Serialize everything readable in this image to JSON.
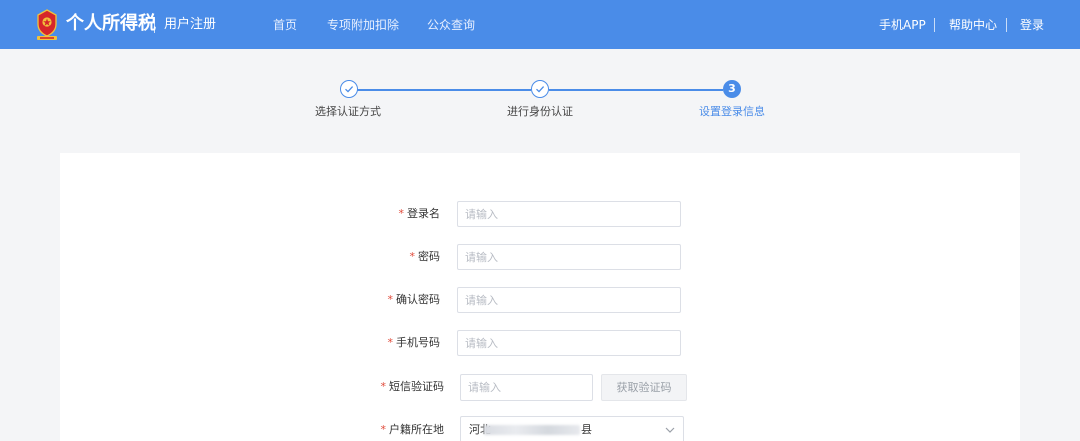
{
  "header": {
    "brand": "个人所得税",
    "subtitle": "用户注册",
    "nav": {
      "home": "首页",
      "deduction": "专项附加扣除",
      "public_query": "公众查询"
    },
    "right": {
      "app": "手机APP",
      "help": "帮助中心",
      "login": "登录"
    }
  },
  "steps": [
    {
      "label": "选择认证方式",
      "status": "done"
    },
    {
      "label": "进行身份认证",
      "status": "done"
    },
    {
      "label": "设置登录信息",
      "status": "current",
      "number": "3"
    }
  ],
  "form": {
    "required_mark": "*",
    "username": {
      "label": "登录名",
      "placeholder": "请输入",
      "value": ""
    },
    "password": {
      "label": "密码",
      "placeholder": "请输入",
      "value": ""
    },
    "confirm_password": {
      "label": "确认密码",
      "placeholder": "请输入",
      "value": ""
    },
    "phone": {
      "label": "手机号码",
      "placeholder": "请输入",
      "value": ""
    },
    "sms_code": {
      "label": "短信验证码",
      "placeholder": "请输入",
      "value": "",
      "button": "获取验证码"
    },
    "residence": {
      "label": "户籍所在地",
      "value_prefix": "河北",
      "value_suffix": "县"
    }
  },
  "colors": {
    "primary": "#4a8ce8",
    "required": "#e04a3a",
    "background": "#f4f5f7"
  }
}
